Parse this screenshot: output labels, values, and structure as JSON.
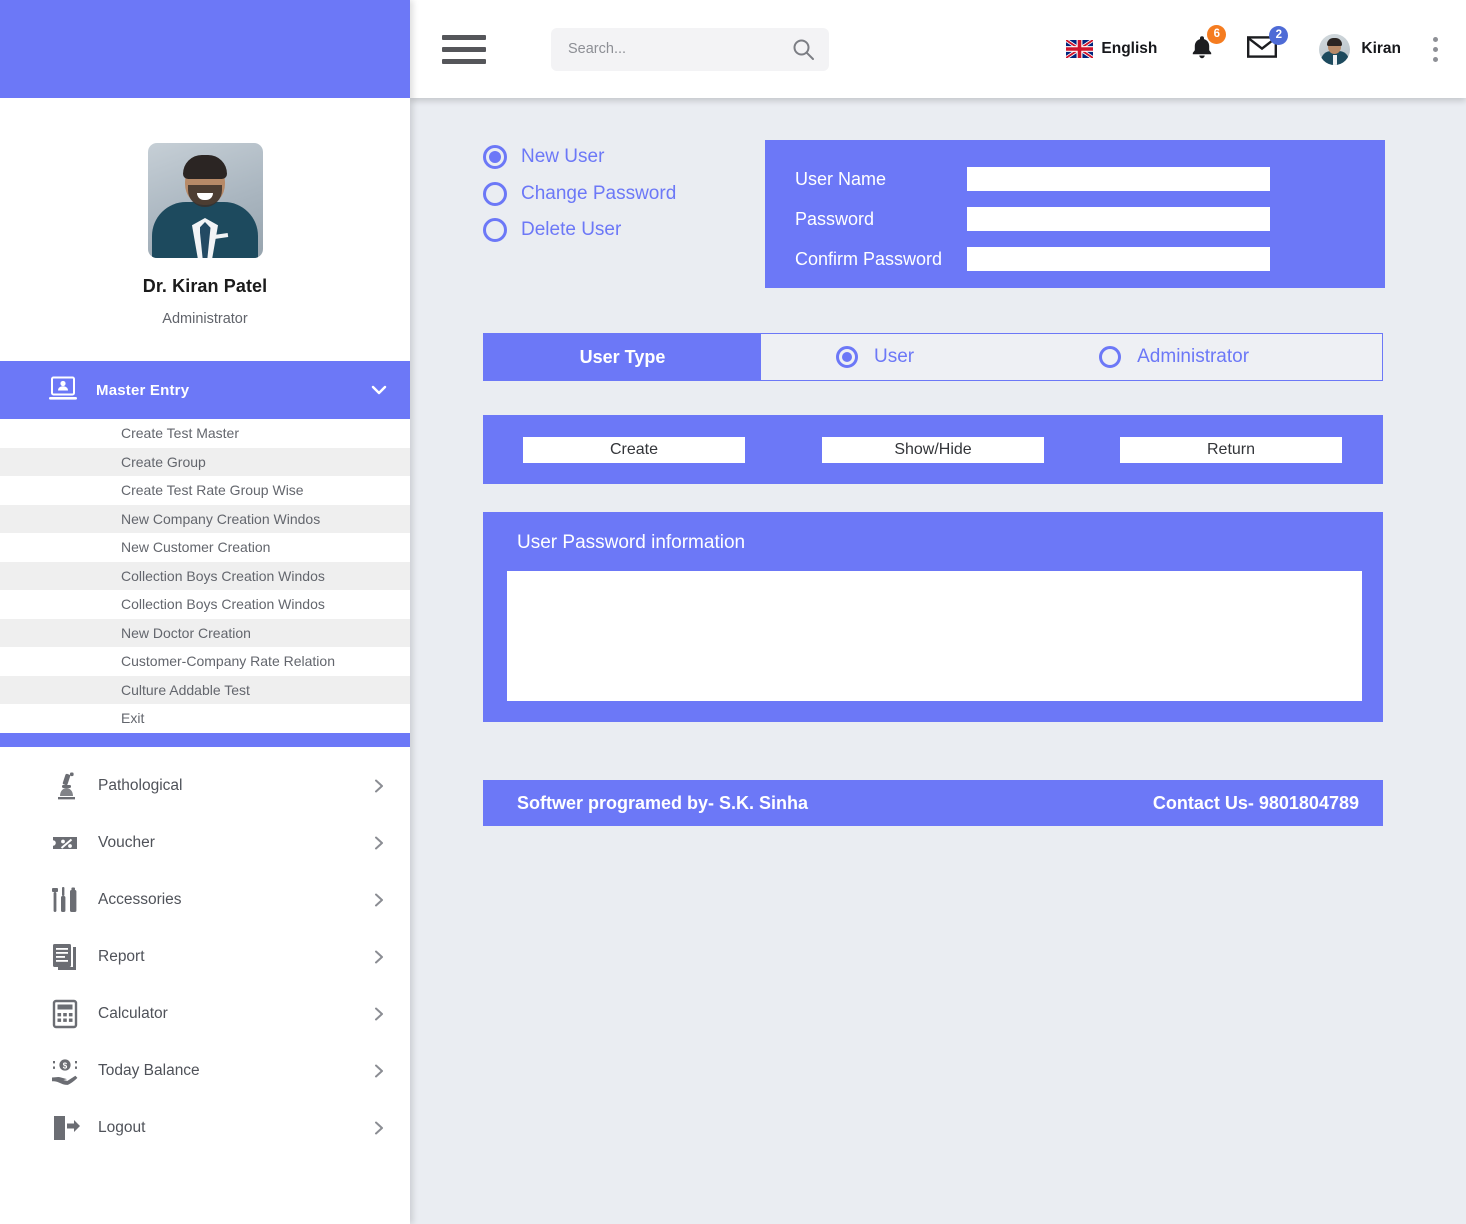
{
  "sidebar": {
    "profile": {
      "avatar_name": "user-photo",
      "name": "Dr. Kiran Patel",
      "role": "Administrator"
    },
    "master_entry": {
      "label": "Master Entry",
      "icon": "computer-user-icon",
      "chevron": "chevron-down-icon",
      "submenu": [
        "Create Test Master",
        "Create Group",
        "Create Test Rate Group Wise",
        "New Company Creation Windos",
        "New Customer Creation",
        "Collection Boys Creation Windos",
        "Collection Boys Creation Windos",
        "New Doctor Creation",
        "Customer-Company Rate Relation",
        "Culture Addable Test",
        "Exit"
      ]
    },
    "nav_items": [
      {
        "label": "Pathological",
        "icon": "microscope-icon"
      },
      {
        "label": "Voucher",
        "icon": "voucher-percent-icon"
      },
      {
        "label": "Accessories",
        "icon": "test-tubes-icon"
      },
      {
        "label": "Report",
        "icon": "document-report-icon"
      },
      {
        "label": "Calculator",
        "icon": "calculator-icon"
      },
      {
        "label": "Today Balance",
        "icon": "hand-money-icon"
      },
      {
        "label": "Logout",
        "icon": "logout-icon"
      }
    ]
  },
  "topbar": {
    "hamburger": "hamburger-menu-icon",
    "search": {
      "value": "",
      "placeholder": "Search...",
      "icon": "search-icon"
    },
    "language": {
      "flag": "uk-flag-icon",
      "label": "English"
    },
    "notifications": {
      "icon": "bell-icon",
      "count": "6",
      "color": "#f57c20"
    },
    "messages": {
      "icon": "envelope-icon",
      "count": "2",
      "color": "#4e6bd6"
    },
    "user": {
      "avatar": "user-avatar",
      "name": "Kiran"
    },
    "kebab": "more-options-icon"
  },
  "main": {
    "mode_options": [
      {
        "label": "New User",
        "selected": true
      },
      {
        "label": "Change Password",
        "selected": false
      },
      {
        "label": "Delete User",
        "selected": false
      }
    ],
    "credentials": [
      {
        "label": "User Name",
        "value": ""
      },
      {
        "label": "Password",
        "value": ""
      },
      {
        "label": "Confirm Password",
        "value": ""
      }
    ],
    "user_type": {
      "label": "User Type",
      "options": [
        {
          "label": "User",
          "selected": true
        },
        {
          "label": "Administrator",
          "selected": false
        }
      ]
    },
    "actions": [
      {
        "label": "Create"
      },
      {
        "label": "Show/Hide"
      },
      {
        "label": "Return"
      }
    ],
    "info_panel": {
      "title": "User Password information",
      "content": ""
    },
    "footer": {
      "left": "Softwer programed by- S.K. Sinha",
      "right": "Contact Us- 9801804789"
    }
  },
  "colors": {
    "accent": "#6c78f7",
    "background": "#eaedf2",
    "badge_orange": "#f57c20",
    "badge_blue": "#4e6bd6"
  }
}
